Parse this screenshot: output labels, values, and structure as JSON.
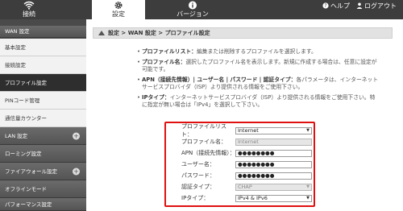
{
  "nav": {
    "tabs": [
      {
        "label": "接続",
        "icon": "wifi-icon"
      },
      {
        "label": "設定",
        "icon": "gear-icon"
      },
      {
        "label": "バージョン",
        "icon": "info-icon"
      }
    ],
    "help": "ヘルプ",
    "logout": "ログアウト"
  },
  "sidebar": {
    "items": [
      {
        "label": "WAN 設定"
      },
      {
        "label": "基本設定"
      },
      {
        "label": "接続設定"
      },
      {
        "label": "プロファイル設定"
      },
      {
        "label": "PINコード管理"
      },
      {
        "label": "通信量カウンター"
      },
      {
        "label": "LAN 設定"
      },
      {
        "label": "ローミング設定"
      },
      {
        "label": "ファイアウォール設定"
      },
      {
        "label": "オフラインモード"
      },
      {
        "label": "パフォーマンス設定"
      }
    ]
  },
  "breadcrumb": "設定 > WAN 設定 > プロファイル設定",
  "description": [
    {
      "term": "プロファイルリスト：",
      "text": "編集または削除するプロファイルを選択します。"
    },
    {
      "term": "プロファイル名：",
      "text": "選択したプロファイル名を表示します。新規に作成する場合は、任意に設定が可能です。"
    },
    {
      "term": "APN（接続先情報）| ユーザー名 | パスワード | 認証タイプ：",
      "text": "各パラメータは、インターネットサービスプロバイダ（ISP）より提供される情報をご使用下さい。"
    },
    {
      "term": "IPタイプ：",
      "text": "インターネットサービスプロバイダ（ISP）より提供される情報をご使用下さい。特に指定が無い場合は「IPv4」を選択して下さい。"
    }
  ],
  "form": {
    "profile_list": {
      "label": "プロファイルリスト：",
      "value": "Internet"
    },
    "profile_name": {
      "label": "プロファイル名：",
      "value": "Internet"
    },
    "apn": {
      "label": "APN（接続先情報）：",
      "value": "●●●●●●●●"
    },
    "username": {
      "label": "ユーザー名：",
      "value": "●●●●●●●●"
    },
    "password": {
      "label": "パスワード：",
      "value": "●●●●●●●●"
    },
    "auth_type": {
      "label": "認証タイプ：",
      "value": "CHAP"
    },
    "ip_type": {
      "label": "IPタイプ：",
      "value": "IPv4 & IPv6"
    }
  },
  "colors": {
    "highlight": "#e01010",
    "nav_bg": "#3d3d3d"
  }
}
